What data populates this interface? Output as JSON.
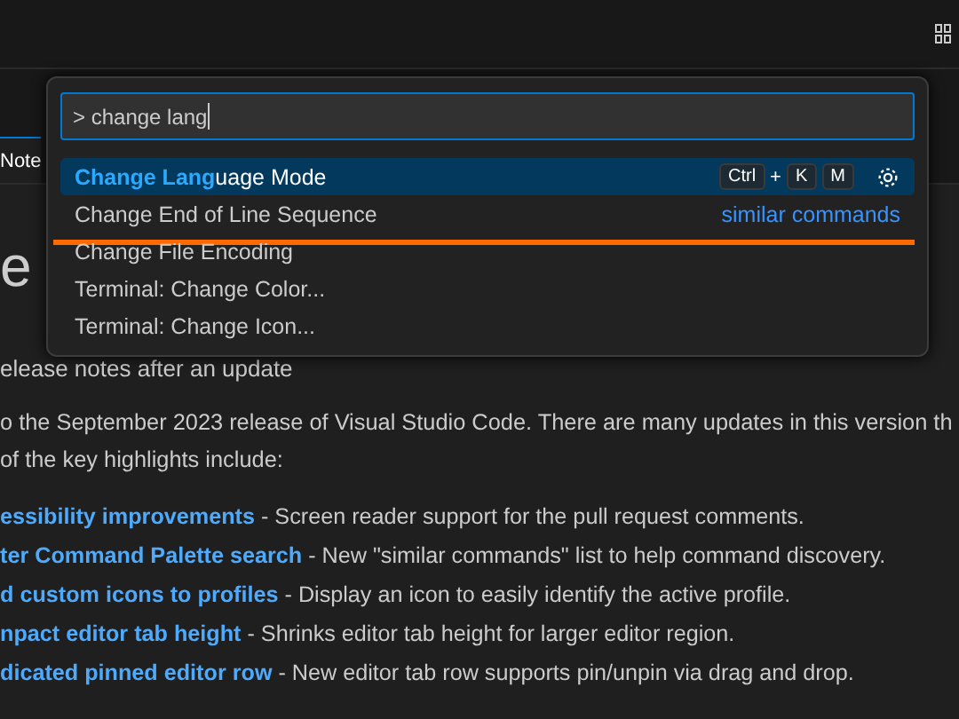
{
  "tab": {
    "label": "Note",
    "selected": true
  },
  "heading": "e",
  "subtitle": "elease notes after an update",
  "intro": [
    "o the September 2023 release of Visual Studio Code. There are many updates in this version th",
    " of the key highlights include:"
  ],
  "highlights": [
    {
      "title": "essibility improvements",
      "text": " - Screen reader support for the pull request comments."
    },
    {
      "title": "ter Command Palette search",
      "text": " - New \"similar commands\" list to help command discovery."
    },
    {
      "title": "d custom icons to profiles",
      "text": " - Display an icon to easily identify the active profile."
    },
    {
      "title": "npact editor tab height",
      "text": " - Shrinks editor tab height for larger editor region."
    },
    {
      "title": "dicated pinned editor row",
      "text": " - New editor tab row supports pin/unpin via drag and drop."
    }
  ],
  "palette": {
    "input": "> change lang",
    "items": [
      {
        "label": "**Change Lang**uage Mode",
        "selected": true,
        "keys": [
          "Ctrl",
          "+",
          "K",
          "M"
        ],
        "gear": true
      },
      {
        "label": "Change End of Line Sequence",
        "selected": false,
        "tag": "similar commands",
        "underline": true
      },
      {
        "label": "Change File Encoding",
        "selected": false
      },
      {
        "label": "Terminal: Change Color...",
        "selected": false
      },
      {
        "label": "Terminal: Change Icon...",
        "selected": false
      }
    ]
  }
}
